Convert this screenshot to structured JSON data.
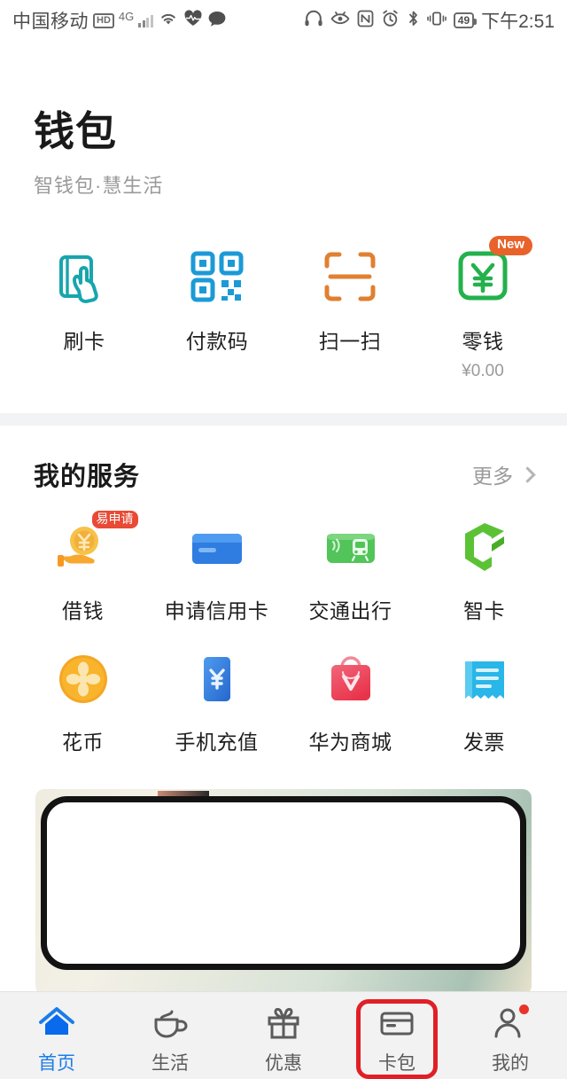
{
  "status_bar": {
    "carrier": "中国移动",
    "hd_label": "HD",
    "network": "4G",
    "battery_level": "49",
    "time": "下午2:51",
    "left_icons": [
      "hd-icon",
      "4g-icon",
      "signal-bars-icon",
      "wifi-icon",
      "heart-rate-icon",
      "chat-bubble-icon"
    ],
    "right_icons": [
      "headphones-icon",
      "eye-protect-icon",
      "nfc-icon",
      "alarm-clock-icon",
      "bluetooth-icon",
      "vibrate-icon",
      "battery-icon"
    ]
  },
  "header": {
    "title": "钱包",
    "subtitle": "智钱包·慧生活"
  },
  "quick_actions": [
    {
      "label": "刷卡",
      "sub": "",
      "icon": "swipe-card-icon",
      "badge": "",
      "color": "#18a5ad"
    },
    {
      "label": "付款码",
      "sub": "",
      "icon": "payment-qr-icon",
      "badge": "",
      "color": "#1b9ad6"
    },
    {
      "label": "扫一扫",
      "sub": "",
      "icon": "scan-icon",
      "badge": "",
      "color": "#e08030"
    },
    {
      "label": "零钱",
      "sub": "¥0.00",
      "icon": "wallet-balance-icon",
      "badge": "New",
      "color": "#23b14c"
    }
  ],
  "my_services": {
    "title": "我的服务",
    "more_label": "更多",
    "items": [
      {
        "label": "借钱",
        "icon": "loan-hand-coin-icon",
        "badge": "易申请"
      },
      {
        "label": "申请信用卡",
        "icon": "credit-card-icon",
        "badge": ""
      },
      {
        "label": "交通出行",
        "icon": "transit-card-icon",
        "badge": ""
      },
      {
        "label": "智卡",
        "icon": "smart-card-logo-icon",
        "badge": ""
      },
      {
        "label": "花币",
        "icon": "huabi-coin-icon",
        "badge": ""
      },
      {
        "label": "手机充值",
        "icon": "phone-topup-icon",
        "badge": ""
      },
      {
        "label": "华为商城",
        "icon": "shopping-bag-icon",
        "badge": ""
      },
      {
        "label": "发票",
        "icon": "invoice-icon",
        "badge": ""
      }
    ]
  },
  "banner": {
    "alt": "phone-device-banner"
  },
  "tabbar": {
    "items": [
      {
        "label": "首页",
        "icon": "home-icon",
        "active": true,
        "dot": false
      },
      {
        "label": "生活",
        "icon": "cup-icon",
        "active": false,
        "dot": false
      },
      {
        "label": "优惠",
        "icon": "gift-icon",
        "active": false,
        "dot": false
      },
      {
        "label": "卡包",
        "icon": "card-wallet-icon",
        "active": false,
        "dot": false,
        "highlighted": true
      },
      {
        "label": "我的",
        "icon": "person-icon",
        "active": false,
        "dot": true
      }
    ]
  },
  "colors": {
    "accent_blue": "#1b7ce8",
    "highlight_red": "#e01f26",
    "badge_orange": "#e8622a",
    "badge_red": "#e84a36",
    "page_bg": "#ffffff",
    "band_bg": "#f2f3f5",
    "tabbar_bg": "#f2f2f2"
  }
}
